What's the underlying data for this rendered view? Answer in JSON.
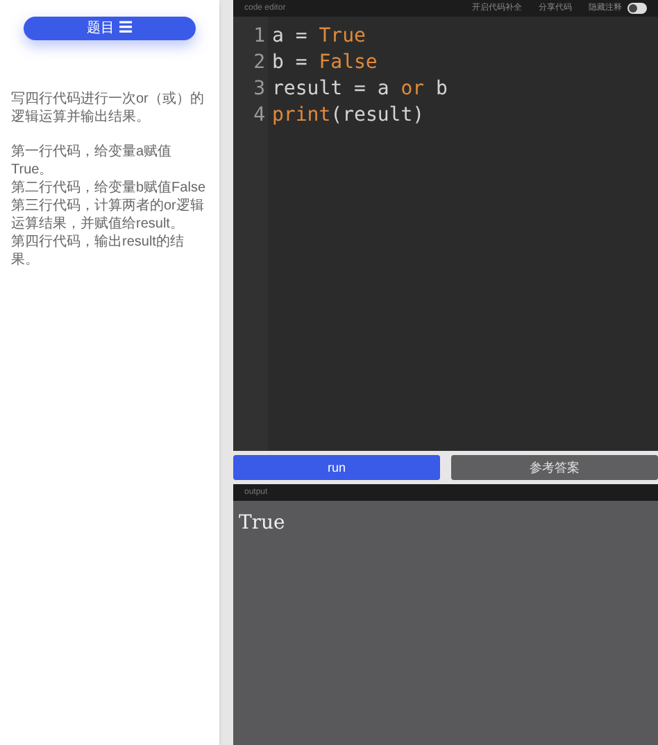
{
  "sidebar": {
    "topic_button": "题目 ☰",
    "paragraphs": [
      [
        "写四行代码进行一次or（或）的逻辑运算并输出结果。"
      ],
      [
        "第一行代码，给变量a赋值True。",
        "第二行代码，给变量b赋值False",
        "第三行代码，计算两者的or逻辑运算结果，并赋值给result。",
        "第四行代码，输出result的结果。"
      ]
    ]
  },
  "editor": {
    "title": "code editor",
    "actions": [
      "开启代码补全",
      "分享代码"
    ],
    "toggle": {
      "label": "隐藏注释",
      "on": false
    },
    "lines": [
      {
        "number": "1",
        "tokens": [
          {
            "text": "a = ",
            "kind": "plain"
          },
          {
            "text": "True",
            "kind": "keyword"
          }
        ]
      },
      {
        "number": "2",
        "tokens": [
          {
            "text": "b = ",
            "kind": "plain"
          },
          {
            "text": "False",
            "kind": "keyword"
          }
        ]
      },
      {
        "number": "3",
        "tokens": [
          {
            "text": "result = a ",
            "kind": "plain"
          },
          {
            "text": "or",
            "kind": "keyword"
          },
          {
            "text": " b",
            "kind": "plain"
          }
        ]
      },
      {
        "number": "4",
        "tokens": [
          {
            "text": "print",
            "kind": "keyword"
          },
          {
            "text": "(result)",
            "kind": "plain"
          }
        ]
      }
    ]
  },
  "buttons": [
    {
      "label": "run",
      "kind": "primary"
    },
    {
      "label": "参考答案",
      "kind": "secondary"
    }
  ],
  "output": {
    "title": "output",
    "text": "True"
  }
}
